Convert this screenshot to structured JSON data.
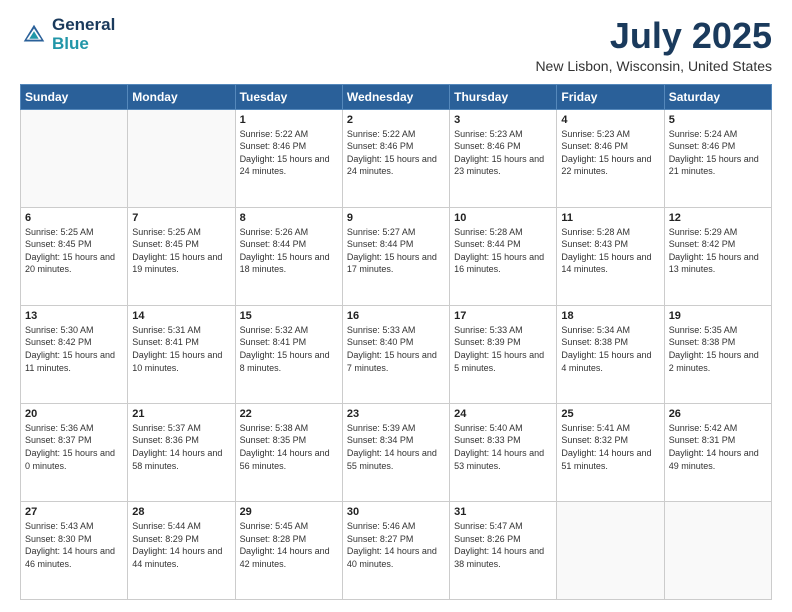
{
  "header": {
    "logo_line1": "General",
    "logo_line2": "Blue",
    "month": "July 2025",
    "location": "New Lisbon, Wisconsin, United States"
  },
  "weekdays": [
    "Sunday",
    "Monday",
    "Tuesday",
    "Wednesday",
    "Thursday",
    "Friday",
    "Saturday"
  ],
  "weeks": [
    [
      {
        "day": "",
        "sunrise": "",
        "sunset": "",
        "daylight": ""
      },
      {
        "day": "",
        "sunrise": "",
        "sunset": "",
        "daylight": ""
      },
      {
        "day": "1",
        "sunrise": "Sunrise: 5:22 AM",
        "sunset": "Sunset: 8:46 PM",
        "daylight": "Daylight: 15 hours and 24 minutes."
      },
      {
        "day": "2",
        "sunrise": "Sunrise: 5:22 AM",
        "sunset": "Sunset: 8:46 PM",
        "daylight": "Daylight: 15 hours and 24 minutes."
      },
      {
        "day": "3",
        "sunrise": "Sunrise: 5:23 AM",
        "sunset": "Sunset: 8:46 PM",
        "daylight": "Daylight: 15 hours and 23 minutes."
      },
      {
        "day": "4",
        "sunrise": "Sunrise: 5:23 AM",
        "sunset": "Sunset: 8:46 PM",
        "daylight": "Daylight: 15 hours and 22 minutes."
      },
      {
        "day": "5",
        "sunrise": "Sunrise: 5:24 AM",
        "sunset": "Sunset: 8:46 PM",
        "daylight": "Daylight: 15 hours and 21 minutes."
      }
    ],
    [
      {
        "day": "6",
        "sunrise": "Sunrise: 5:25 AM",
        "sunset": "Sunset: 8:45 PM",
        "daylight": "Daylight: 15 hours and 20 minutes."
      },
      {
        "day": "7",
        "sunrise": "Sunrise: 5:25 AM",
        "sunset": "Sunset: 8:45 PM",
        "daylight": "Daylight: 15 hours and 19 minutes."
      },
      {
        "day": "8",
        "sunrise": "Sunrise: 5:26 AM",
        "sunset": "Sunset: 8:44 PM",
        "daylight": "Daylight: 15 hours and 18 minutes."
      },
      {
        "day": "9",
        "sunrise": "Sunrise: 5:27 AM",
        "sunset": "Sunset: 8:44 PM",
        "daylight": "Daylight: 15 hours and 17 minutes."
      },
      {
        "day": "10",
        "sunrise": "Sunrise: 5:28 AM",
        "sunset": "Sunset: 8:44 PM",
        "daylight": "Daylight: 15 hours and 16 minutes."
      },
      {
        "day": "11",
        "sunrise": "Sunrise: 5:28 AM",
        "sunset": "Sunset: 8:43 PM",
        "daylight": "Daylight: 15 hours and 14 minutes."
      },
      {
        "day": "12",
        "sunrise": "Sunrise: 5:29 AM",
        "sunset": "Sunset: 8:42 PM",
        "daylight": "Daylight: 15 hours and 13 minutes."
      }
    ],
    [
      {
        "day": "13",
        "sunrise": "Sunrise: 5:30 AM",
        "sunset": "Sunset: 8:42 PM",
        "daylight": "Daylight: 15 hours and 11 minutes."
      },
      {
        "day": "14",
        "sunrise": "Sunrise: 5:31 AM",
        "sunset": "Sunset: 8:41 PM",
        "daylight": "Daylight: 15 hours and 10 minutes."
      },
      {
        "day": "15",
        "sunrise": "Sunrise: 5:32 AM",
        "sunset": "Sunset: 8:41 PM",
        "daylight": "Daylight: 15 hours and 8 minutes."
      },
      {
        "day": "16",
        "sunrise": "Sunrise: 5:33 AM",
        "sunset": "Sunset: 8:40 PM",
        "daylight": "Daylight: 15 hours and 7 minutes."
      },
      {
        "day": "17",
        "sunrise": "Sunrise: 5:33 AM",
        "sunset": "Sunset: 8:39 PM",
        "daylight": "Daylight: 15 hours and 5 minutes."
      },
      {
        "day": "18",
        "sunrise": "Sunrise: 5:34 AM",
        "sunset": "Sunset: 8:38 PM",
        "daylight": "Daylight: 15 hours and 4 minutes."
      },
      {
        "day": "19",
        "sunrise": "Sunrise: 5:35 AM",
        "sunset": "Sunset: 8:38 PM",
        "daylight": "Daylight: 15 hours and 2 minutes."
      }
    ],
    [
      {
        "day": "20",
        "sunrise": "Sunrise: 5:36 AM",
        "sunset": "Sunset: 8:37 PM",
        "daylight": "Daylight: 15 hours and 0 minutes."
      },
      {
        "day": "21",
        "sunrise": "Sunrise: 5:37 AM",
        "sunset": "Sunset: 8:36 PM",
        "daylight": "Daylight: 14 hours and 58 minutes."
      },
      {
        "day": "22",
        "sunrise": "Sunrise: 5:38 AM",
        "sunset": "Sunset: 8:35 PM",
        "daylight": "Daylight: 14 hours and 56 minutes."
      },
      {
        "day": "23",
        "sunrise": "Sunrise: 5:39 AM",
        "sunset": "Sunset: 8:34 PM",
        "daylight": "Daylight: 14 hours and 55 minutes."
      },
      {
        "day": "24",
        "sunrise": "Sunrise: 5:40 AM",
        "sunset": "Sunset: 8:33 PM",
        "daylight": "Daylight: 14 hours and 53 minutes."
      },
      {
        "day": "25",
        "sunrise": "Sunrise: 5:41 AM",
        "sunset": "Sunset: 8:32 PM",
        "daylight": "Daylight: 14 hours and 51 minutes."
      },
      {
        "day": "26",
        "sunrise": "Sunrise: 5:42 AM",
        "sunset": "Sunset: 8:31 PM",
        "daylight": "Daylight: 14 hours and 49 minutes."
      }
    ],
    [
      {
        "day": "27",
        "sunrise": "Sunrise: 5:43 AM",
        "sunset": "Sunset: 8:30 PM",
        "daylight": "Daylight: 14 hours and 46 minutes."
      },
      {
        "day": "28",
        "sunrise": "Sunrise: 5:44 AM",
        "sunset": "Sunset: 8:29 PM",
        "daylight": "Daylight: 14 hours and 44 minutes."
      },
      {
        "day": "29",
        "sunrise": "Sunrise: 5:45 AM",
        "sunset": "Sunset: 8:28 PM",
        "daylight": "Daylight: 14 hours and 42 minutes."
      },
      {
        "day": "30",
        "sunrise": "Sunrise: 5:46 AM",
        "sunset": "Sunset: 8:27 PM",
        "daylight": "Daylight: 14 hours and 40 minutes."
      },
      {
        "day": "31",
        "sunrise": "Sunrise: 5:47 AM",
        "sunset": "Sunset: 8:26 PM",
        "daylight": "Daylight: 14 hours and 38 minutes."
      },
      {
        "day": "",
        "sunrise": "",
        "sunset": "",
        "daylight": ""
      },
      {
        "day": "",
        "sunrise": "",
        "sunset": "",
        "daylight": ""
      }
    ]
  ]
}
